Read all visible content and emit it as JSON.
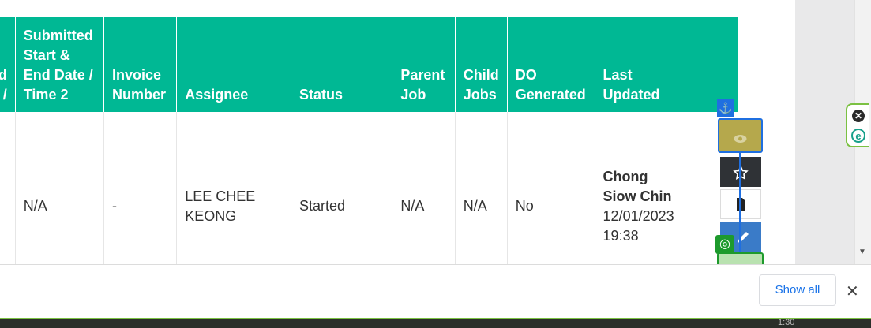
{
  "table": {
    "headers": [
      "ed\ne /",
      "Submitted\nStart &\nEnd Date /\nTime 2",
      "Invoice\nNumber",
      "Assignee",
      "Status",
      "Parent\nJob",
      "Child\nJobs",
      "DO\nGenerated",
      "Last\nUpdated",
      ""
    ],
    "row": {
      "partial": "",
      "submitted": "N/A",
      "invoice": "-",
      "assignee": "LEE CHEE\nKEONG",
      "status": "Started",
      "parent_job": "N/A",
      "child_jobs": "N/A",
      "do_generated": "No",
      "last_updated_by": "Chong\nSiow Chin",
      "last_updated_at": "12/01/2023\n19:38"
    }
  },
  "action_buttons": [
    "eye-icon",
    "star-icon",
    "document-icon",
    "edit-icon"
  ],
  "bottom": {
    "show_all": "Show all",
    "close": "✕"
  },
  "taskbar": {
    "time": "1:30"
  },
  "extension": {
    "close": "✕",
    "logo": "e"
  },
  "colors": {
    "header_bg": "#00b894",
    "view_btn": "#b5a84c",
    "star_btn": "#2f3236",
    "edit_btn": "#3a7bc8",
    "anchor_blue": "#1f6fe0",
    "target_green": "#1d9a2c"
  }
}
